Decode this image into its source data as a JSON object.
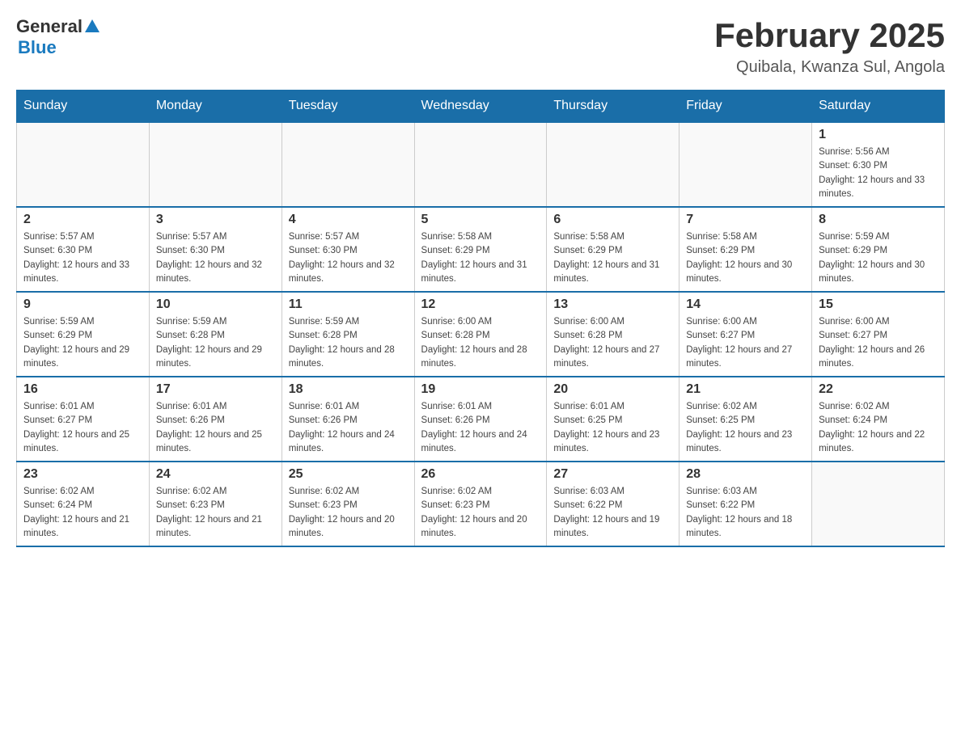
{
  "header": {
    "logo": {
      "general": "General",
      "blue": "Blue"
    },
    "title": "February 2025",
    "subtitle": "Quibala, Kwanza Sul, Angola"
  },
  "days_of_week": [
    "Sunday",
    "Monday",
    "Tuesday",
    "Wednesday",
    "Thursday",
    "Friday",
    "Saturday"
  ],
  "weeks": [
    {
      "days": [
        {
          "number": "",
          "sunrise": "",
          "sunset": "",
          "daylight": ""
        },
        {
          "number": "",
          "sunrise": "",
          "sunset": "",
          "daylight": ""
        },
        {
          "number": "",
          "sunrise": "",
          "sunset": "",
          "daylight": ""
        },
        {
          "number": "",
          "sunrise": "",
          "sunset": "",
          "daylight": ""
        },
        {
          "number": "",
          "sunrise": "",
          "sunset": "",
          "daylight": ""
        },
        {
          "number": "",
          "sunrise": "",
          "sunset": "",
          "daylight": ""
        },
        {
          "number": "1",
          "sunrise": "Sunrise: 5:56 AM",
          "sunset": "Sunset: 6:30 PM",
          "daylight": "Daylight: 12 hours and 33 minutes."
        }
      ]
    },
    {
      "days": [
        {
          "number": "2",
          "sunrise": "Sunrise: 5:57 AM",
          "sunset": "Sunset: 6:30 PM",
          "daylight": "Daylight: 12 hours and 33 minutes."
        },
        {
          "number": "3",
          "sunrise": "Sunrise: 5:57 AM",
          "sunset": "Sunset: 6:30 PM",
          "daylight": "Daylight: 12 hours and 32 minutes."
        },
        {
          "number": "4",
          "sunrise": "Sunrise: 5:57 AM",
          "sunset": "Sunset: 6:30 PM",
          "daylight": "Daylight: 12 hours and 32 minutes."
        },
        {
          "number": "5",
          "sunrise": "Sunrise: 5:58 AM",
          "sunset": "Sunset: 6:29 PM",
          "daylight": "Daylight: 12 hours and 31 minutes."
        },
        {
          "number": "6",
          "sunrise": "Sunrise: 5:58 AM",
          "sunset": "Sunset: 6:29 PM",
          "daylight": "Daylight: 12 hours and 31 minutes."
        },
        {
          "number": "7",
          "sunrise": "Sunrise: 5:58 AM",
          "sunset": "Sunset: 6:29 PM",
          "daylight": "Daylight: 12 hours and 30 minutes."
        },
        {
          "number": "8",
          "sunrise": "Sunrise: 5:59 AM",
          "sunset": "Sunset: 6:29 PM",
          "daylight": "Daylight: 12 hours and 30 minutes."
        }
      ]
    },
    {
      "days": [
        {
          "number": "9",
          "sunrise": "Sunrise: 5:59 AM",
          "sunset": "Sunset: 6:29 PM",
          "daylight": "Daylight: 12 hours and 29 minutes."
        },
        {
          "number": "10",
          "sunrise": "Sunrise: 5:59 AM",
          "sunset": "Sunset: 6:28 PM",
          "daylight": "Daylight: 12 hours and 29 minutes."
        },
        {
          "number": "11",
          "sunrise": "Sunrise: 5:59 AM",
          "sunset": "Sunset: 6:28 PM",
          "daylight": "Daylight: 12 hours and 28 minutes."
        },
        {
          "number": "12",
          "sunrise": "Sunrise: 6:00 AM",
          "sunset": "Sunset: 6:28 PM",
          "daylight": "Daylight: 12 hours and 28 minutes."
        },
        {
          "number": "13",
          "sunrise": "Sunrise: 6:00 AM",
          "sunset": "Sunset: 6:28 PM",
          "daylight": "Daylight: 12 hours and 27 minutes."
        },
        {
          "number": "14",
          "sunrise": "Sunrise: 6:00 AM",
          "sunset": "Sunset: 6:27 PM",
          "daylight": "Daylight: 12 hours and 27 minutes."
        },
        {
          "number": "15",
          "sunrise": "Sunrise: 6:00 AM",
          "sunset": "Sunset: 6:27 PM",
          "daylight": "Daylight: 12 hours and 26 minutes."
        }
      ]
    },
    {
      "days": [
        {
          "number": "16",
          "sunrise": "Sunrise: 6:01 AM",
          "sunset": "Sunset: 6:27 PM",
          "daylight": "Daylight: 12 hours and 25 minutes."
        },
        {
          "number": "17",
          "sunrise": "Sunrise: 6:01 AM",
          "sunset": "Sunset: 6:26 PM",
          "daylight": "Daylight: 12 hours and 25 minutes."
        },
        {
          "number": "18",
          "sunrise": "Sunrise: 6:01 AM",
          "sunset": "Sunset: 6:26 PM",
          "daylight": "Daylight: 12 hours and 24 minutes."
        },
        {
          "number": "19",
          "sunrise": "Sunrise: 6:01 AM",
          "sunset": "Sunset: 6:26 PM",
          "daylight": "Daylight: 12 hours and 24 minutes."
        },
        {
          "number": "20",
          "sunrise": "Sunrise: 6:01 AM",
          "sunset": "Sunset: 6:25 PM",
          "daylight": "Daylight: 12 hours and 23 minutes."
        },
        {
          "number": "21",
          "sunrise": "Sunrise: 6:02 AM",
          "sunset": "Sunset: 6:25 PM",
          "daylight": "Daylight: 12 hours and 23 minutes."
        },
        {
          "number": "22",
          "sunrise": "Sunrise: 6:02 AM",
          "sunset": "Sunset: 6:24 PM",
          "daylight": "Daylight: 12 hours and 22 minutes."
        }
      ]
    },
    {
      "days": [
        {
          "number": "23",
          "sunrise": "Sunrise: 6:02 AM",
          "sunset": "Sunset: 6:24 PM",
          "daylight": "Daylight: 12 hours and 21 minutes."
        },
        {
          "number": "24",
          "sunrise": "Sunrise: 6:02 AM",
          "sunset": "Sunset: 6:23 PM",
          "daylight": "Daylight: 12 hours and 21 minutes."
        },
        {
          "number": "25",
          "sunrise": "Sunrise: 6:02 AM",
          "sunset": "Sunset: 6:23 PM",
          "daylight": "Daylight: 12 hours and 20 minutes."
        },
        {
          "number": "26",
          "sunrise": "Sunrise: 6:02 AM",
          "sunset": "Sunset: 6:23 PM",
          "daylight": "Daylight: 12 hours and 20 minutes."
        },
        {
          "number": "27",
          "sunrise": "Sunrise: 6:03 AM",
          "sunset": "Sunset: 6:22 PM",
          "daylight": "Daylight: 12 hours and 19 minutes."
        },
        {
          "number": "28",
          "sunrise": "Sunrise: 6:03 AM",
          "sunset": "Sunset: 6:22 PM",
          "daylight": "Daylight: 12 hours and 18 minutes."
        },
        {
          "number": "",
          "sunrise": "",
          "sunset": "",
          "daylight": ""
        }
      ]
    }
  ]
}
